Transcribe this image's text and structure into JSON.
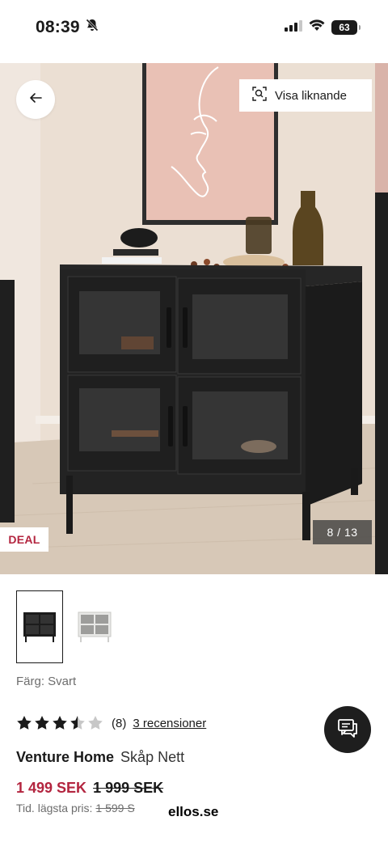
{
  "status_bar": {
    "time": "08:39",
    "battery": "63",
    "icons": [
      "bell-slash-icon",
      "signal-icon",
      "wifi-icon",
      "battery-icon"
    ]
  },
  "hero": {
    "back_icon": "arrow-left-icon",
    "similar_label": "Visa liknande",
    "similar_icon": "visual-search-icon",
    "deal_label": "DEAL",
    "counter": "8 / 13"
  },
  "thumbnails": [
    {
      "label": "black-cabinet",
      "selected": true
    },
    {
      "label": "white-cabinet",
      "selected": false
    }
  ],
  "product": {
    "color_label": "Färg: Svart",
    "rating": 3.5,
    "rating_max": 5,
    "rating_count": "(8)",
    "reviews_link": "3 recensioner",
    "brand": "Venture Home",
    "name": "Skåp Nett",
    "price_now": "1 499 SEK",
    "price_old": "1 999 SEK",
    "lowest_label": "Tid. lägsta pris:",
    "lowest_price": "1 599 S"
  },
  "chat_icon": "chat-bubbles-icon",
  "browser": {
    "domain": "ellos.se"
  },
  "colors": {
    "sale_red": "#b3253f",
    "dark": "#1a1a1a"
  }
}
